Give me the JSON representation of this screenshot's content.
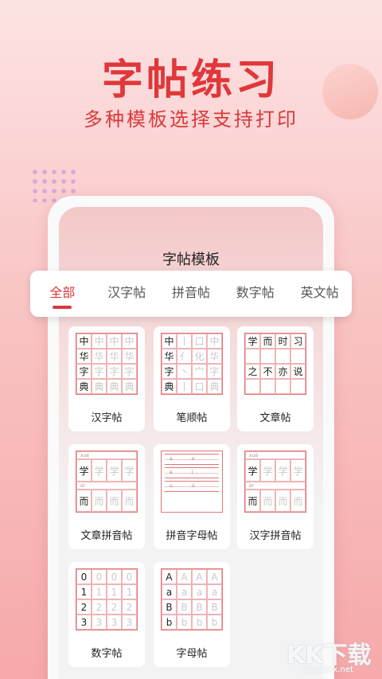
{
  "hero": {
    "title": "字帖练习",
    "subtitle": "多种模板选择支持打印"
  },
  "screen": {
    "title": "字帖模板"
  },
  "tabs": [
    {
      "label": "全部",
      "active": true
    },
    {
      "label": "汉字帖",
      "active": false
    },
    {
      "label": "拼音帖",
      "active": false
    },
    {
      "label": "数字帖",
      "active": false
    },
    {
      "label": "英文帖",
      "active": false
    }
  ],
  "templates": [
    {
      "label": "汉字帖",
      "chars": [
        "中",
        "中",
        "中",
        "中",
        "华",
        "华",
        "华",
        "华",
        "字",
        "字",
        "字",
        "字",
        "典",
        "典",
        "典",
        "典"
      ]
    },
    {
      "label": "笔顺帖",
      "chars": [
        "中",
        "丨",
        "口",
        "中",
        "华",
        "亻",
        "化",
        "华",
        "字",
        "丶",
        "宀",
        "字",
        "典",
        "丨",
        "口",
        "典"
      ]
    },
    {
      "label": "文章帖",
      "chars": [
        "学",
        "而",
        "时",
        "习",
        "",
        "",
        "",
        "",
        "之",
        "不",
        "亦",
        "说",
        "",
        "",
        "",
        ""
      ]
    },
    {
      "label": "文章拼音帖",
      "pinyin": [
        "xué",
        "ér"
      ],
      "chars": [
        "学",
        "学",
        "学",
        "学",
        "而",
        "而",
        "而",
        "而"
      ]
    },
    {
      "label": "拼音字母帖",
      "letters": [
        "a",
        "o",
        "e",
        "i",
        "u",
        "ü"
      ]
    },
    {
      "label": "汉字拼音帖",
      "pinyin": [
        "xué",
        "ér"
      ],
      "chars": [
        "学",
        "学",
        "学",
        "学",
        "而",
        "而",
        "而",
        "而"
      ]
    },
    {
      "label": "数字帖",
      "chars": [
        "0",
        "0",
        "0",
        "0",
        "1",
        "1",
        "1",
        "1",
        "2",
        "2",
        "2",
        "2",
        "3",
        "3",
        "3",
        "3"
      ]
    },
    {
      "label": "字母帖",
      "chars": [
        "A",
        "A",
        "A",
        "A",
        "a",
        "a",
        "a",
        "a",
        "B",
        "B",
        "B",
        "B",
        "b",
        "b",
        "b",
        "b"
      ]
    }
  ],
  "watermark": {
    "brand": "KK下载",
    "url": "www.kkx.net"
  },
  "colors": {
    "accent": "#d8393b",
    "grid": "#e07576",
    "background_top": "#fde3e3",
    "background_bottom": "#f6a9aa"
  }
}
